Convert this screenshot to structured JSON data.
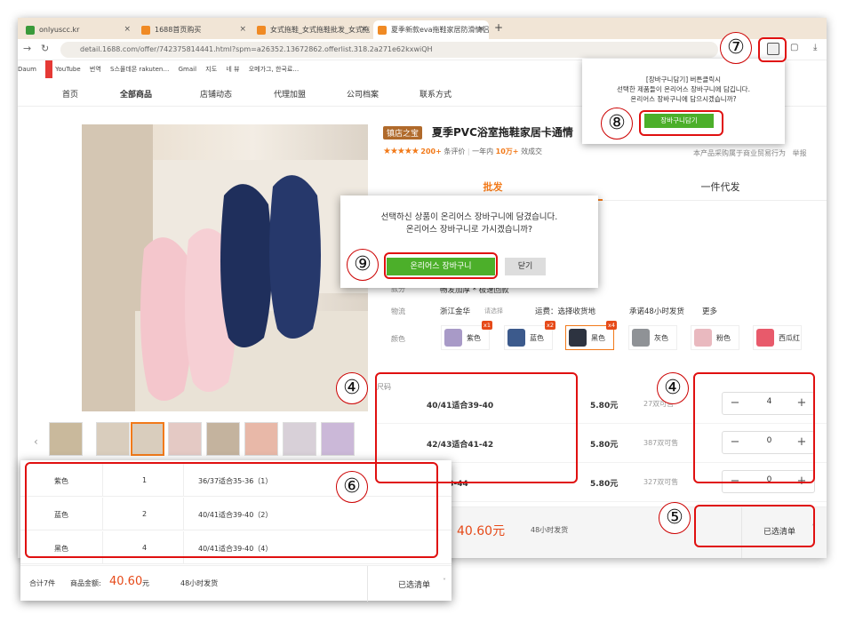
{
  "browser": {
    "tabs": [
      {
        "label": "onlyuscc.kr",
        "close": "×"
      },
      {
        "label": "1688首页购买",
        "close": "×"
      },
      {
        "label": "女式拖鞋_女式拖鞋批发_女式拖",
        "close": "×"
      },
      {
        "label": "夏季新款eva拖鞋家居防滑情侣浴",
        "close": "×"
      }
    ],
    "new_tab": "+",
    "url": "detail.1688.com/offer/742375814441.html?spm=a26352.13672862.offerlist.318.2a271e62kxwiQH",
    "bookmarks": [
      "Daum",
      "YouTube",
      "번역",
      "S스몰데몬 rakuten…",
      "Gmail",
      "지도",
      "네 뷰",
      "오메가그, 한국료…"
    ]
  },
  "shop_nav": [
    "首页",
    "全部商品",
    "店铺动态",
    "代理加盟",
    "公司档案",
    "联系方式"
  ],
  "product": {
    "badge": "镇店之宝",
    "title": "夏季PVC浴室拖鞋家居卡通情",
    "stars": "★★★★★",
    "reviews": "200+",
    "reviews_label": "条评价",
    "sales_prefix": "一年内",
    "sales": "10万+",
    "sales_suffix": "效成交",
    "notice": "本产品采购属于商业贸易行为",
    "report": "举报",
    "tab_wholesale": "批发",
    "tab_dropship": "一件代发",
    "style_label": "款分",
    "style_value": "畅发加厚 * 极速回款",
    "logistics_label": "物流",
    "logistics_from": "浙江金华",
    "logistics_select": "请选择",
    "shipping_fee": "运费：选择收货地",
    "promise": "承诺48小时发货",
    "more": "更多",
    "color_label": "颜色",
    "size_label": "尺码"
  },
  "colors": [
    {
      "name": "紫色",
      "count": "x1",
      "swatch": "#a89ac7"
    },
    {
      "name": "蓝色",
      "count": "x2",
      "swatch": "#3c5a8c"
    },
    {
      "name": "黑色",
      "count": "x4",
      "swatch": "#2d3340"
    },
    {
      "name": "灰色",
      "count": "",
      "swatch": "#8f9296"
    },
    {
      "name": "粉色",
      "count": "",
      "swatch": "#e9b9bf"
    },
    {
      "name": "西瓜红",
      "count": "",
      "swatch": "#e85a6b"
    }
  ],
  "sizes": [
    {
      "size": "40/41适合39-40",
      "price": "5.80元",
      "stock": "27双可售",
      "qty": "4"
    },
    {
      "size": "42/43适合41-42",
      "price": "5.80元",
      "stock": "387双可售",
      "qty": "0"
    },
    {
      "size": "适合43-44",
      "price": "5.80元",
      "stock": "327双可售",
      "qty": "0"
    }
  ],
  "stepper": {
    "minus": "−",
    "plus": "+"
  },
  "bottom": {
    "amount": "40.60元",
    "ship": "48小时发货",
    "list": "已选清单"
  },
  "ext_popup": {
    "line1": "[장바구니담기] 버튼클릭시",
    "line2": "선택한 제품들이 온리어스 장바구니에 담깁니다.",
    "line3": "온리어스 장바구니에 담으시겠습니까?",
    "button": "장바구니담기"
  },
  "dialog": {
    "line1": "선택하신 상품이 온리어스 장바구니에 담겼습니다.",
    "line2": "온리어스 장바구니로 가시겠습니까?",
    "ok": "온리어스 장바구니",
    "close": "닫기"
  },
  "zoom": {
    "rows": [
      {
        "color": "紫色",
        "qty": "1",
        "size": "36/37适合35-36（1）"
      },
      {
        "color": "蓝色",
        "qty": "2",
        "size": "40/41适合39-40（2）"
      },
      {
        "color": "黑色",
        "qty": "4",
        "size": "40/41适合39-40（4）"
      }
    ],
    "total": "合计7件",
    "amount_label": "商品金额:",
    "amount": "40.60",
    "amount_unit": "元",
    "ship": "48小时发货",
    "list": "已选清单"
  },
  "annotations": [
    "④",
    "④",
    "⑤",
    "⑥",
    "⑦",
    "⑧",
    "⑨"
  ],
  "accent": "#f27a1a",
  "highlight": "#e01010",
  "confirm_green": "#4caf2a"
}
